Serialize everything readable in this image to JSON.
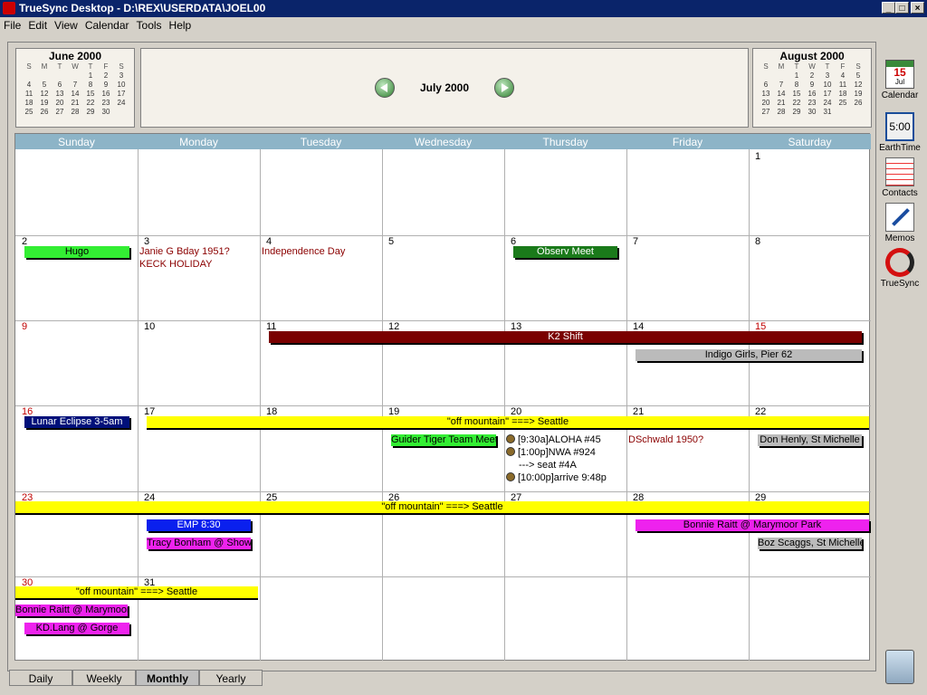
{
  "window": {
    "title": "TrueSync Desktop - D:\\REX\\USERDATA\\JOEL00"
  },
  "menu": [
    "File",
    "Edit",
    "View",
    "Calendar",
    "Tools",
    "Help"
  ],
  "prev_mini": {
    "title": "June 2000",
    "dow": [
      "S",
      "M",
      "T",
      "W",
      "T",
      "F",
      "S"
    ],
    "weeks": [
      [
        "",
        "",
        "",
        "",
        "1",
        "2",
        "3"
      ],
      [
        "4",
        "5",
        "6",
        "7",
        "8",
        "9",
        "10"
      ],
      [
        "11",
        "12",
        "13",
        "14",
        "15",
        "16",
        "17"
      ],
      [
        "18",
        "19",
        "20",
        "21",
        "22",
        "23",
        "24"
      ],
      [
        "25",
        "26",
        "27",
        "28",
        "29",
        "30",
        ""
      ]
    ]
  },
  "next_mini": {
    "title": "August 2000",
    "dow": [
      "S",
      "M",
      "T",
      "W",
      "T",
      "F",
      "S"
    ],
    "weeks": [
      [
        "",
        "",
        "1",
        "2",
        "3",
        "4",
        "5"
      ],
      [
        "6",
        "7",
        "8",
        "9",
        "10",
        "11",
        "12"
      ],
      [
        "13",
        "14",
        "15",
        "16",
        "17",
        "18",
        "19"
      ],
      [
        "20",
        "21",
        "22",
        "23",
        "24",
        "25",
        "26"
      ],
      [
        "27",
        "28",
        "29",
        "30",
        "31",
        "",
        ""
      ]
    ]
  },
  "current_month": "July 2000",
  "days": [
    "Sunday",
    "Monday",
    "Tuesday",
    "Wednesday",
    "Thursday",
    "Friday",
    "Saturday"
  ],
  "daynums": [
    "1",
    "2",
    "3",
    "4",
    "5",
    "6",
    "7",
    "8",
    "9",
    "10",
    "11",
    "12",
    "13",
    "14",
    "15",
    "16",
    "17",
    "18",
    "19",
    "20",
    "21",
    "22",
    "23",
    "24",
    "25",
    "26",
    "27",
    "28",
    "29",
    "30",
    "31"
  ],
  "events": {
    "hugo": "Hugo",
    "janie": "Janie G Bday 1951?",
    "keck": "KECK HOLIDAY",
    "indep": "Independence Day",
    "observ": "Observ Meet",
    "k2": "K2 Shift",
    "indigo": "Indigo Girls, Pier 62",
    "lunar": "Lunar Eclipse 3-5am",
    "offmtn": "\"off mountain\" ===> Seattle",
    "guider": "Guider Tiger Team Meet",
    "aloha": "[9:30a]ALOHA #45",
    "nwa": "[1:00p]NWA #924",
    "seat": "---> seat #4A",
    "arrive": "[10:00p]arrive 9:48p",
    "dschwald": "DSchwald 1950?",
    "henly": "Don Henly, St Michelle",
    "emp": "EMP 8:30",
    "tracy": "Tracy Bonham @ Show",
    "bonnie_park": "Bonnie Raitt @ Marymoor Park",
    "boz": "Boz Scaggs, St Michelle",
    "bonnie": "Bonnie Raitt @ Marymoor",
    "kdlang": "KD.Lang @ Gorge"
  },
  "view_tabs": [
    "Daily",
    "Weekly",
    "Monthly",
    "Yearly"
  ],
  "sidebar": {
    "calendar": "Calendar",
    "earthtime": "EarthTime",
    "contacts": "Contacts",
    "memos": "Memos",
    "truesync": "TrueSync",
    "cal_month": "Jul",
    "cal_day": "15",
    "clock": "5:00"
  }
}
